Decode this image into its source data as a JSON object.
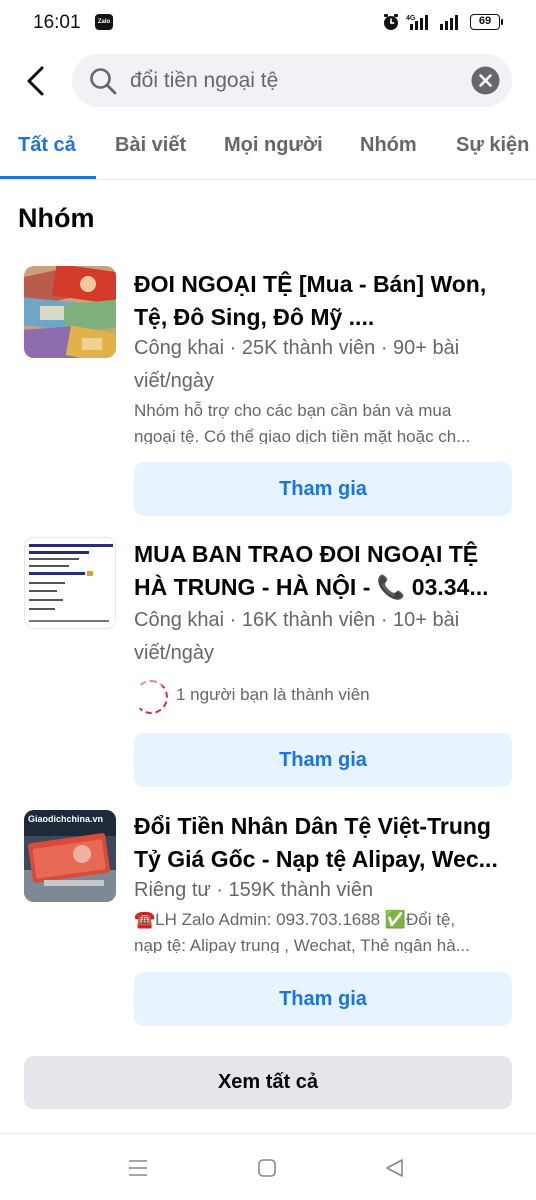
{
  "status_bar": {
    "time": "16:01",
    "zalo_label": "Zalo",
    "network_label": "4G",
    "battery": "69"
  },
  "search": {
    "query": "đổi tiền ngoại tệ",
    "icon": "search-icon"
  },
  "tabs": [
    {
      "label": "Tất cả",
      "active": true
    },
    {
      "label": "Bài viết",
      "active": false
    },
    {
      "label": "Mọi người",
      "active": false
    },
    {
      "label": "Nhóm",
      "active": false
    },
    {
      "label": "Sự kiện",
      "active": false
    }
  ],
  "section": {
    "title": "Nhóm"
  },
  "groups": [
    {
      "title_line1": "ĐOI NGOẠI TỆ [Mua - Bán] Won,",
      "title_line2": "Tệ, Đô Sing, Đô Mỹ ....",
      "meta_line1": "Công khai · 25K thành viên · 90+ bài",
      "meta_line2": "viết/ngày",
      "desc_line1": "Nhóm hỗ trợ cho các bạn cần bán và mua",
      "desc_line2": "ngoại tệ. Có thể giao dịch tiền mặt hoặc ch...",
      "join_label": "Tham gia"
    },
    {
      "title_line1": "MUA BAN TRAO ĐOI  NGOẠI TỆ",
      "title_line2": "HÀ TRUNG - HÀ NỘI - 📞 03.34...",
      "meta_line1": "Công khai · 16K thành viên · 10+ bài",
      "meta_line2": "viết/ngày",
      "friends_text": "1 người bạn là thành viên",
      "join_label": "Tham gia"
    },
    {
      "title_line1": "Đổi Tiền Nhân Dân Tệ Việt-Trung",
      "title_line2": "Tỷ Giá Gốc - Nạp tệ Alipay, Wec...",
      "meta_line1": "Riêng tư · 159K thành viên",
      "desc_line1": "☎️LH Zalo Admin: 093.703.1688 ✅Đổi tệ,",
      "desc_line2": "nạp tệ: Alipay trung , Wechat, Thẻ ngân hà...",
      "thumb_label": "Giaodichchina.vn",
      "join_label": "Tham gia"
    }
  ],
  "see_all_label": "Xem tất cả",
  "colors": {
    "accent": "#1b74e4",
    "join_bg": "#e7f3ff",
    "search_bg": "#f0f2f5",
    "secondary_text": "#65676b"
  }
}
